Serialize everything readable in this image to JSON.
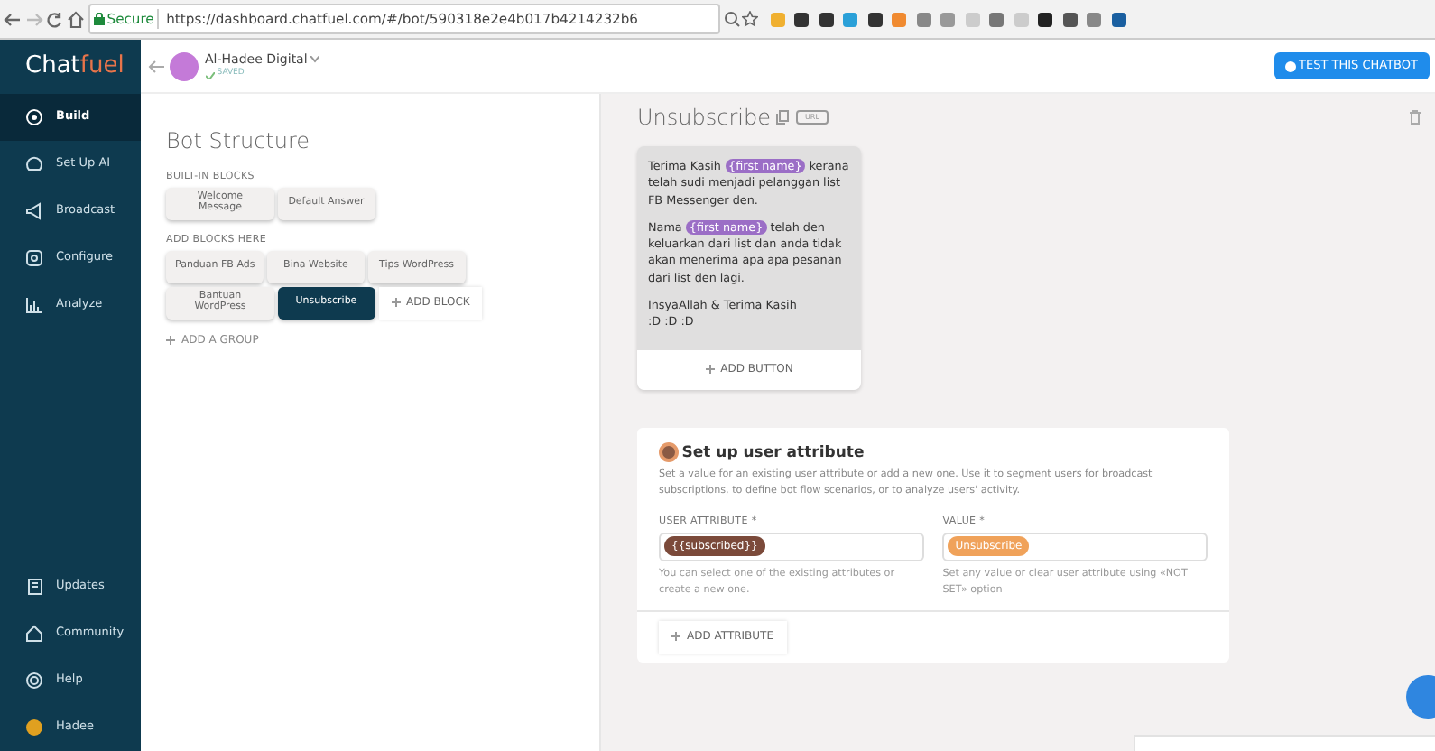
{
  "browser": {
    "security": "Secure",
    "url": "https://dashboard.chatfuel.com/#/bot/590318e2e4b017b4214232b6"
  },
  "logo": {
    "part_1": "Chat",
    "part_2": "fuel"
  },
  "bot": {
    "name": "Al-Hadee Digital",
    "status": "SAVED"
  },
  "test_button": "TEST THIS CHATBOT",
  "sidebar": {
    "items": [
      {
        "label": "Build",
        "selected": true
      },
      {
        "label": "Set Up AI",
        "selected": false
      },
      {
        "label": "Broadcast",
        "selected": false
      },
      {
        "label": "Configure",
        "selected": false
      },
      {
        "label": "Analyze",
        "selected": false
      }
    ],
    "bottom_items": [
      {
        "label": "Updates"
      },
      {
        "label": "Community"
      },
      {
        "label": "Help"
      },
      {
        "label": "Hadee"
      }
    ]
  },
  "structure": {
    "title": "Bot Structure",
    "groups": [
      {
        "heading": "BUILT-IN BLOCKS",
        "blocks": [
          {
            "label": "Welcome Message",
            "selected": false
          },
          {
            "label": "Default Answer",
            "selected": false
          }
        ]
      },
      {
        "heading": "ADD BLOCKS HERE",
        "blocks": [
          {
            "label": "Panduan FB Ads",
            "selected": false
          },
          {
            "label": "Bina Website",
            "selected": false
          },
          {
            "label": "Tips WordPress",
            "selected": false
          },
          {
            "label": "Bantuan WordPress",
            "selected": false
          },
          {
            "label": "Unsubscribe",
            "selected": true
          }
        ],
        "add_label": "ADD BLOCK"
      }
    ],
    "add_group": "ADD A GROUP"
  },
  "block": {
    "title": "Unsubscribe",
    "url_tag": "URL",
    "message": {
      "paragraphs": [
        [
          {
            "kind": "text",
            "text": "Terima Kasih "
          },
          {
            "kind": "variable",
            "text": "{first name}"
          },
          {
            "kind": "text",
            "text": " kerana telah sudi menjadi pelanggan list FB Messenger den."
          }
        ],
        [
          {
            "kind": "text",
            "text": "Nama "
          },
          {
            "kind": "variable",
            "text": "{first name}"
          },
          {
            "kind": "text",
            "text": " telah den keluarkan dari list dan anda tidak akan menerima apa apa pesanan dari list den lagi."
          }
        ],
        [
          {
            "kind": "text",
            "text": "InsyaAllah & Terima Kasih"
          },
          {
            "kind": "break"
          },
          {
            "kind": "text",
            "text": ":D :D :D"
          }
        ]
      ],
      "add_button": "ADD BUTTON"
    },
    "attribute": {
      "title": "Set up user attribute",
      "description": "Set a value for an existing user attribute or add a new one. Use it to segment users for broadcast subscriptions, to define bot flow scenarios, or to analyze users' activity.",
      "fields": [
        {
          "label": "USER ATTRIBUTE *",
          "kind": "attribute",
          "value": "{{subscribed}}",
          "hint": "You can select one of the existing attributes or create a new one."
        },
        {
          "label": "VALUE *",
          "kind": "value",
          "value": "Unsubscribe",
          "hint": "Set any value or clear user attribute using «NOT SET» option"
        }
      ],
      "add_label": "ADD ATTRIBUTE"
    }
  }
}
